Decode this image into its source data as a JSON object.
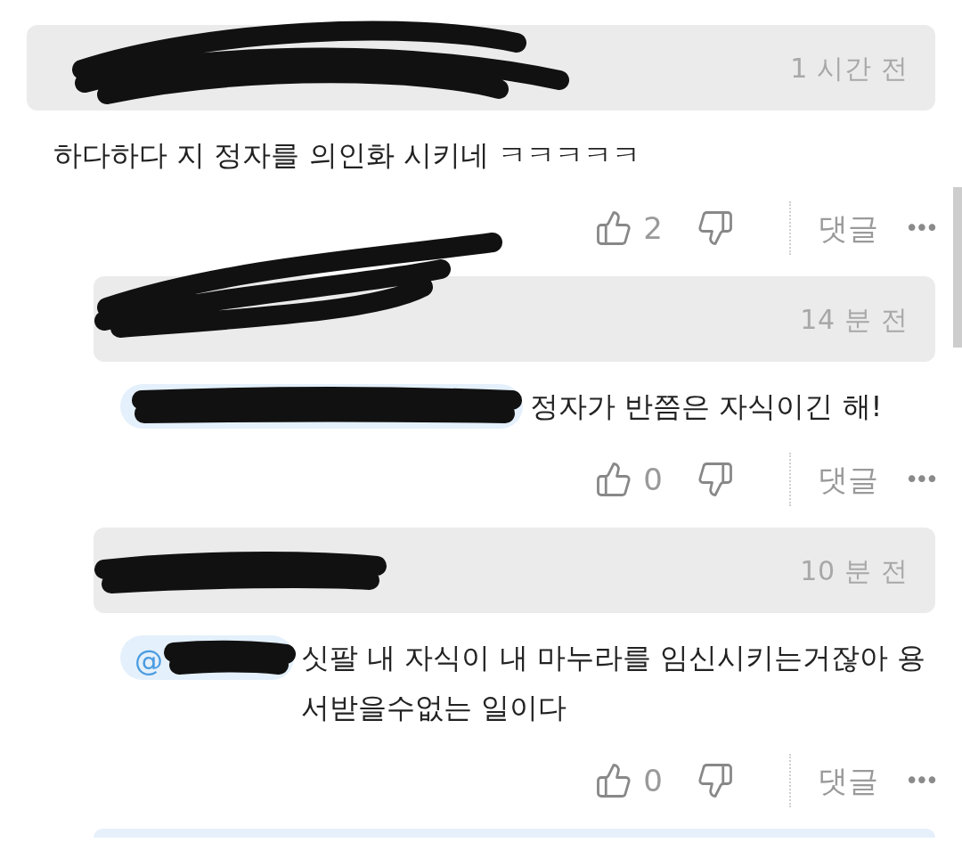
{
  "comment": {
    "time": "1 시간 전",
    "body": "하다하다 지 정자를 의인화 시키네 ㅋㅋㅋㅋㅋ",
    "likes": "2",
    "reply_label": "댓글",
    "more": "•••",
    "replies": [
      {
        "time": "14 분 전",
        "body": "정자가 반쯤은 자식이긴 해!",
        "likes": "0",
        "reply_label": "댓글",
        "more": "•••"
      },
      {
        "time": "10 분 전",
        "mention": "@",
        "body": "싯팔 내 자식이 내 마누라를 임신시키는거잖아 용서받을수없는 일이다",
        "likes": "0",
        "reply_label": "댓글",
        "more": "•••"
      }
    ]
  }
}
